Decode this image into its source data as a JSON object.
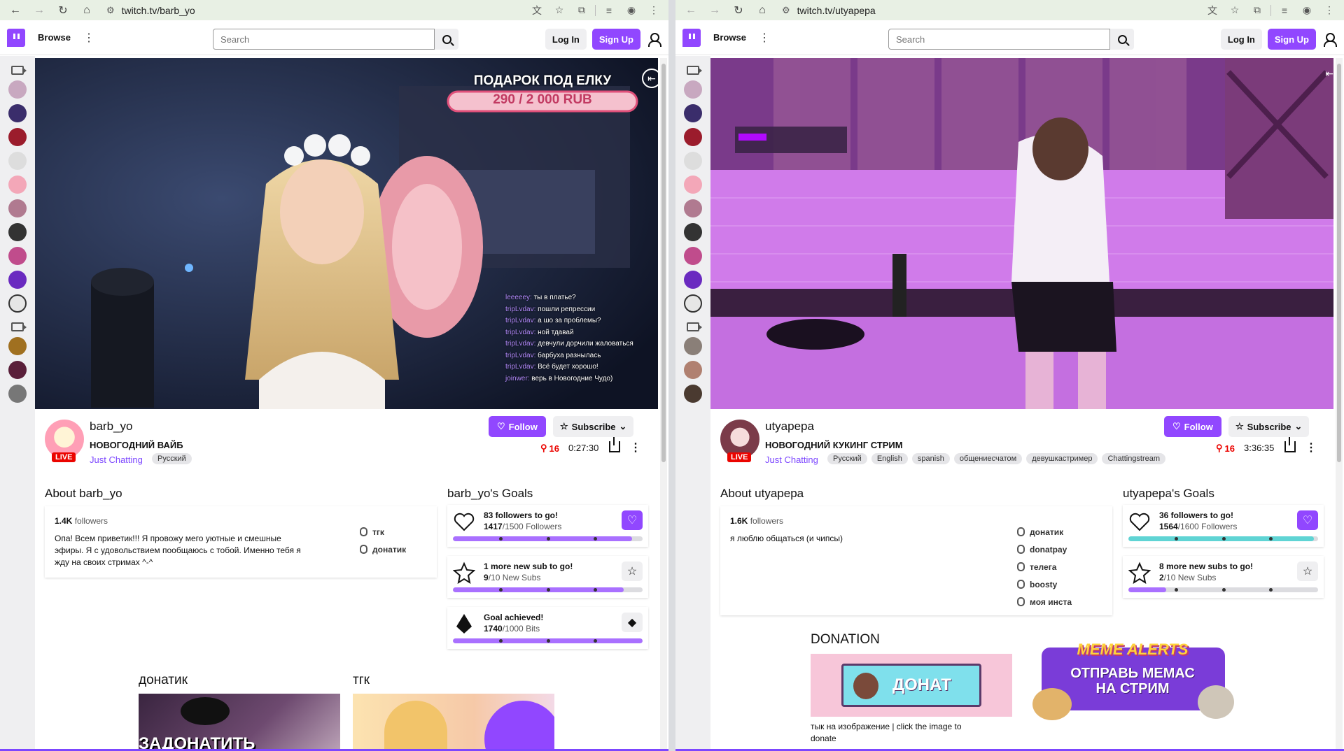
{
  "left": {
    "url": "twitch.tv/barb_yo",
    "browse_label": "Browse",
    "search_placeholder": "Search",
    "login_label": "Log In",
    "signup_label": "Sign Up",
    "overlay_title": "ПОДАРОК ПОД ЕЛКУ",
    "overlay_amount": "290 / 2 000 RUB",
    "chat_lines": [
      {
        "user": "leeeeey:",
        "text": "ты в платье?"
      },
      {
        "user": "tripLvdav:",
        "text": "пошли репрессии"
      },
      {
        "user": "tripLvdav:",
        "text": "а шо за проблемы?"
      },
      {
        "user": "tripLvdav:",
        "text": "ной тдавай"
      },
      {
        "user": "tripLvdav:",
        "text": "девчули дорчили жаловаться"
      },
      {
        "user": "tripLvdav:",
        "text": "барбуха разнылась"
      },
      {
        "user": "tripLvdav:",
        "text": "Всё будет хорошо!"
      },
      {
        "user": "joinwer:",
        "text": "верь в Новогодние Чудо)"
      }
    ],
    "channel_name": "barb_yo",
    "live_label": "LIVE",
    "stream_title": "НОВОГОДНИЙ ВАЙБ",
    "category": "Just Chatting",
    "tags": [
      "Русский"
    ],
    "follow_label": "Follow",
    "subscribe_label": "Subscribe",
    "viewers": "16",
    "uptime": "0:27:30",
    "about_title": "About barb_yo",
    "followers_count": "1.4K",
    "followers_label": "followers",
    "bio_lines": [
      "Опа! Всем приветик!!! Я провожу мего уютные и смешные",
      "эфиры. Я с удовольствием пообщаюсь с тобой. Именно тебя я",
      "жду на своих стримах ^-^"
    ],
    "links": [
      "тгк",
      "донатик"
    ],
    "goals_title": "barb_yo's Goals",
    "goals": [
      {
        "headline": "83 followers to go!",
        "current": "1417",
        "rest": "/1500 Followers",
        "progress": 0.945
      },
      {
        "headline": "1 more new sub to go!",
        "current": "9",
        "rest": "/10 New Subs",
        "progress": 0.9
      },
      {
        "headline": "Goal achieved!",
        "current": "1740",
        "rest": "/1000 Bits",
        "progress": 1.0
      }
    ],
    "panels": [
      {
        "title": "донатик",
        "image_text": "ЗАДОНАТИТЬ"
      },
      {
        "title": "тгк"
      }
    ]
  },
  "right": {
    "url": "twitch.tv/utyapepa",
    "browse_label": "Browse",
    "search_placeholder": "Search",
    "login_label": "Log In",
    "signup_label": "Sign Up",
    "channel_name": "utyapepa",
    "live_label": "LIVE",
    "stream_title": "НОВОГОДНИЙ КУКИНГ СТРИМ",
    "category": "Just Chatting",
    "tags": [
      "Русский",
      "English",
      "spanish",
      "общениесчатом",
      "девушкастример",
      "Chattingstream"
    ],
    "follow_label": "Follow",
    "subscribe_label": "Subscribe",
    "viewers": "16",
    "uptime": "3:36:35",
    "about_title": "About utyapepa",
    "followers_count": "1.6K",
    "followers_label": "followers",
    "bio_lines": [
      "я люблю общаться (и чипсы)"
    ],
    "links": [
      "донатик",
      "donatpay",
      "телега",
      "boosty",
      "моя инста"
    ],
    "goals_title": "utyapepa's Goals",
    "goals": [
      {
        "headline": "36 followers to go!",
        "current": "1564",
        "rest": "/1600 Followers",
        "progress": 0.9775
      },
      {
        "headline": "8 more new subs to go!",
        "current": "2",
        "rest": "/10 New Subs",
        "progress": 0.2
      }
    ],
    "donation_title": "DONATION",
    "donate_button_text": "ДОНАТ",
    "donation_caption_1": "тык на изображение | click the image to",
    "donation_caption_2": "donate",
    "meme_title": "MEME ALERTS",
    "meme_text_1": "ОТПРАВЬ МЕМАС",
    "meme_text_2": "НА СТРИМ"
  },
  "colors": {
    "twitch_purple": "#9147ff",
    "live_red": "#eb0400",
    "goal_purple": "#a970ff",
    "goal_teal": "#5fd4d4"
  }
}
